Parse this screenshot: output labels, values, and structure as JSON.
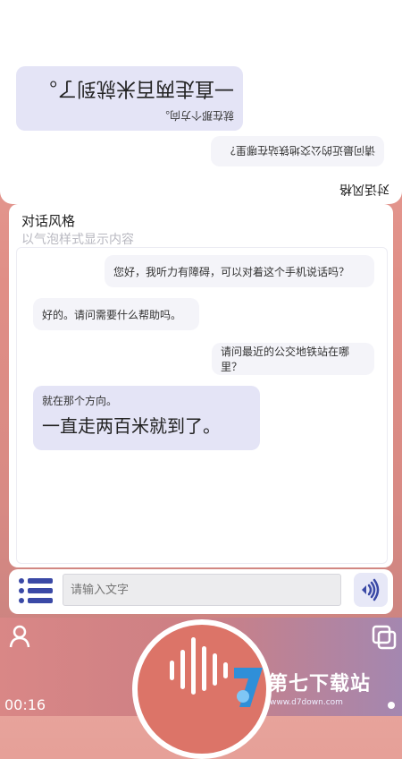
{
  "mirror_panel": {
    "style_title": "对话风格",
    "question": "请问最近的公交地铁站在哪里？",
    "answer_small": "就在那个方向。",
    "answer_large": "一直走两百米就到了。"
  },
  "chat": {
    "style_title": "对话风格",
    "style_subtitle": "以气泡样式显示内容",
    "messages": [
      {
        "side": "right",
        "text": "您好，我听力有障碍，可以对着这个手机说话吗？"
      },
      {
        "side": "left",
        "text": "好的。请问需要什么帮助吗。"
      },
      {
        "side": "right",
        "text": "请问最近的公交地铁站在哪里？"
      },
      {
        "side": "left",
        "small": "就在那个方向。",
        "large": "一直走两百米就到了。"
      }
    ]
  },
  "input": {
    "placeholder": "请输入文字",
    "menu_icon": "list-menu-icon",
    "speak_icon": "speaker-sound-icon"
  },
  "bottom": {
    "timer": "00:16",
    "user_icon": "user-icon",
    "copy_icon": "copy-icon",
    "mic_icon": "voice-wave-icon",
    "watermark_text": "第七下载站",
    "watermark_url": "www.d7down.com"
  },
  "colors": {
    "accent": "#3a49a6",
    "bubble_highlight": "#e4e4f6",
    "record_red": "#dc7468"
  }
}
